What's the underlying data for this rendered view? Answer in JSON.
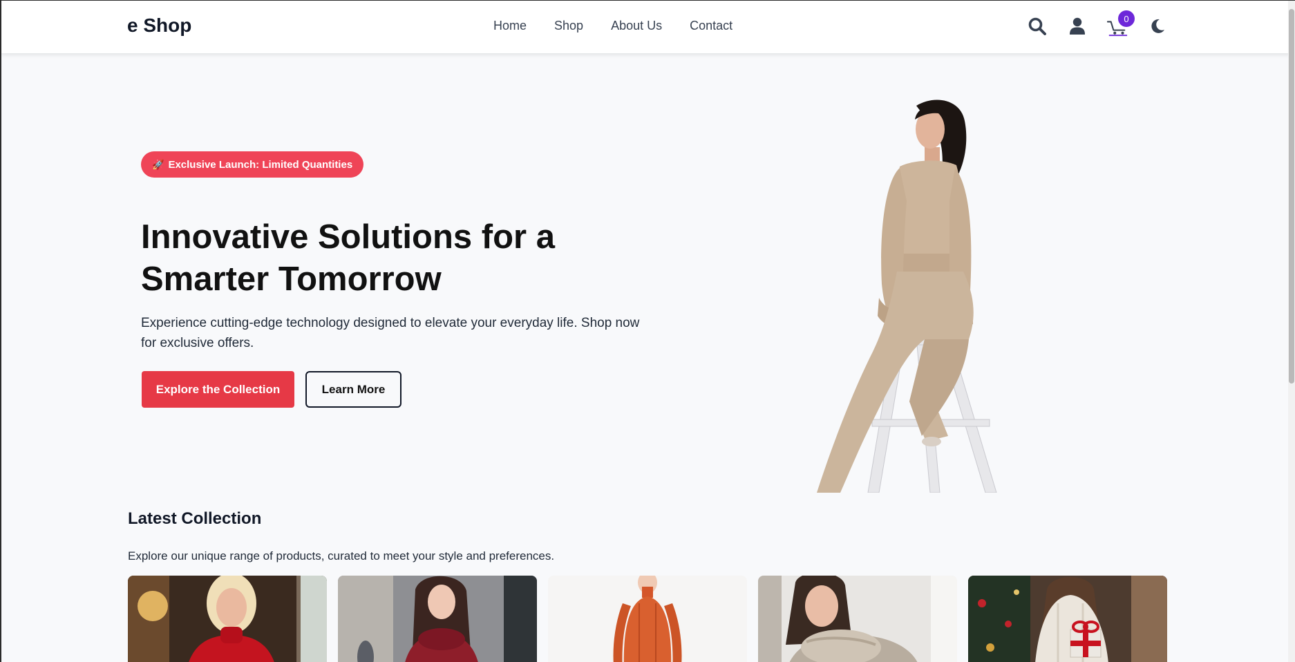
{
  "header": {
    "logo": "e Shop",
    "nav": [
      "Home",
      "Shop",
      "About Us",
      "Contact"
    ],
    "icons": [
      "search-icon",
      "user-icon",
      "cart-icon",
      "moon-icon"
    ],
    "cart_count": "0"
  },
  "hero": {
    "badge_icon": "🚀",
    "badge": "Exclusive Launch: Limited Quantities",
    "title": "Innovative Solutions for a Smarter Tomorrow",
    "description": "Experience cutting-edge technology designed to elevate your everyday life. Shop now for exclusive offers.",
    "primary_button": "Explore the Collection",
    "secondary_button": "Learn More"
  },
  "collection": {
    "title": "Latest Collection",
    "description": "Explore our unique range of products, curated to meet your style and preferences."
  },
  "colors": {
    "badge_red": "#ef4457",
    "primary_red": "#e63946",
    "cart_badge_purple": "#6d28d9",
    "background": "#f8f9fb"
  }
}
